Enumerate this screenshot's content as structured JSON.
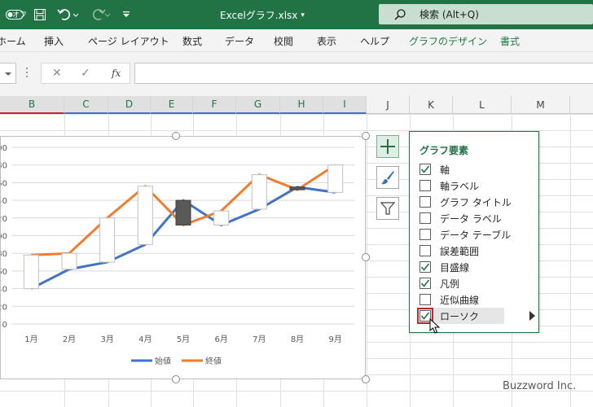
{
  "titlebar": {
    "autosave": "オフ",
    "doc_title": "Excelグラフ.xlsx",
    "doc_title_caret": "▾",
    "search_placeholder": "検索 (Alt+Q)"
  },
  "ribbon": {
    "tabs": [
      {
        "label": "ホーム",
        "name": "tab-home"
      },
      {
        "label": "挿入",
        "name": "tab-insert"
      },
      {
        "label": "ページ レイアウト",
        "name": "tab-page-layout"
      },
      {
        "label": "数式",
        "name": "tab-formulas"
      },
      {
        "label": "データ",
        "name": "tab-data"
      },
      {
        "label": "校閲",
        "name": "tab-review"
      },
      {
        "label": "表示",
        "name": "tab-view"
      },
      {
        "label": "ヘルプ",
        "name": "tab-help"
      },
      {
        "label": "グラフのデザイン",
        "name": "tab-chart-design"
      },
      {
        "label": "書式",
        "name": "tab-format"
      }
    ]
  },
  "formula_bar": {
    "fx": "fx",
    "cancel": "✕",
    "enter": "✓"
  },
  "columns": [
    "B",
    "C",
    "D",
    "E",
    "F",
    "G",
    "H",
    "I",
    "J",
    "K",
    "L",
    "M"
  ],
  "chart_data": {
    "type": "line",
    "categories": [
      "1月",
      "2月",
      "3月",
      "4月",
      "5月",
      "6月",
      "7月",
      "8月",
      "9月"
    ],
    "series": [
      {
        "name": "始値",
        "color": "#4472c4",
        "values": [
          40,
          62,
          70,
          90,
          140,
          112,
          130,
          155,
          149
        ]
      },
      {
        "name": "終値",
        "color": "#ed7d31",
        "values": [
          78,
          80,
          120,
          156,
          112,
          128,
          169,
          152,
          180
        ]
      }
    ],
    "candles": [
      {
        "open": 40,
        "close": 78
      },
      {
        "open": 62,
        "close": 80
      },
      {
        "open": 70,
        "close": 120
      },
      {
        "open": 90,
        "close": 156
      },
      {
        "open": 140,
        "close": 112
      },
      {
        "open": 112,
        "close": 128
      },
      {
        "open": 130,
        "close": 169
      },
      {
        "open": 155,
        "close": 152
      },
      {
        "open": 149,
        "close": 180
      }
    ],
    "up_color": "#ffffff",
    "down_color": "#595959",
    "y_tick_labels": [
      "00",
      "80",
      "60",
      "40",
      "20",
      "00",
      "80",
      "60",
      "40",
      "20",
      "0"
    ],
    "ylim": [
      0,
      200
    ],
    "legend_position": "bottom",
    "grid": true
  },
  "chart_elements": {
    "title": "グラフ要素",
    "items": [
      {
        "label": "軸",
        "checked": true,
        "name": "el-axes"
      },
      {
        "label": "軸ラベル",
        "checked": false,
        "name": "el-axis-titles"
      },
      {
        "label": "グラフ タイトル",
        "checked": false,
        "name": "el-chart-title"
      },
      {
        "label": "データ ラベル",
        "checked": false,
        "name": "el-data-labels"
      },
      {
        "label": "データ テーブル",
        "checked": false,
        "name": "el-data-table"
      },
      {
        "label": "誤差範囲",
        "checked": false,
        "name": "el-error-bars"
      },
      {
        "label": "目盛線",
        "checked": true,
        "name": "el-gridlines"
      },
      {
        "label": "凡例",
        "checked": true,
        "name": "el-legend"
      },
      {
        "label": "近似曲線",
        "checked": false,
        "name": "el-trendline"
      },
      {
        "label": "ローソク",
        "checked": true,
        "name": "el-up-down-bars"
      }
    ]
  },
  "watermark": "Buzzword Inc."
}
